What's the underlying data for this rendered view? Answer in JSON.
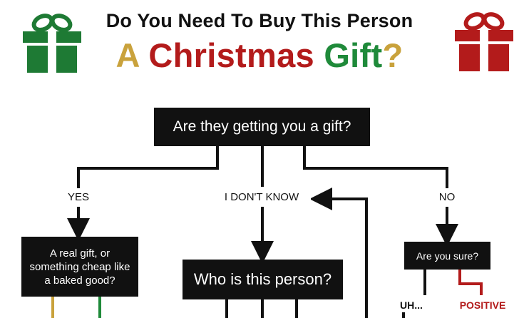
{
  "title": {
    "line1": "Do You Need To Buy This Person",
    "line2_word1": "A",
    "line2_word2": "Christmas",
    "line2_word3": "Gift",
    "line2_punct": "?"
  },
  "colors": {
    "gold": "#c9a23c",
    "red": "#b31b1b",
    "green": "#1f8a3a",
    "dark": "#111111",
    "gift_green": "#1e7a34",
    "gift_red": "#b31b1b"
  },
  "icons": {
    "left_gift": "green-gift-box-icon",
    "right_gift": "red-gift-box-icon"
  },
  "nodes": {
    "q1": "Are they getting you a gift?",
    "q_real_gift": "A real gift, or something cheap like a baked good?",
    "q_who": "Who is this person?",
    "q_sure": "Are you sure?"
  },
  "labels": {
    "yes": "YES",
    "dont_know": "I DON'T KNOW",
    "no": "NO",
    "uh": "UH...",
    "positive": "POSITIVE"
  }
}
